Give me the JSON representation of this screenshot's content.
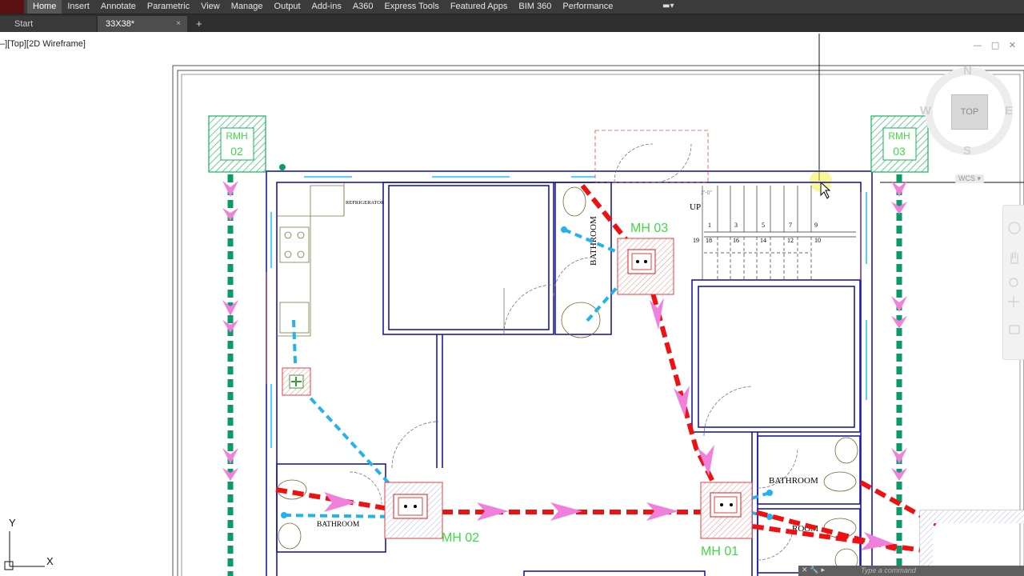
{
  "ribbon": {
    "tabs": [
      "Home",
      "Insert",
      "Annotate",
      "Parametric",
      "View",
      "Manage",
      "Output",
      "Add-ins",
      "A360",
      "Express Tools",
      "Featured Apps",
      "BIM 360",
      "Performance"
    ],
    "active_tab": "Home"
  },
  "file_tabs": {
    "start": "Start",
    "drawing": "33X38*",
    "close": "×",
    "add": "+"
  },
  "viewport": {
    "label": "–][Top][2D Wireframe]",
    "window_controls": "— □ ✕"
  },
  "nav_cube": {
    "n": "N",
    "s": "S",
    "e": "E",
    "w": "W",
    "face": "TOP",
    "wcs": "WCS ▾"
  },
  "command_line": {
    "buttons": "✕ 🔧 ▸",
    "placeholder": "Type a command"
  },
  "ucs": {
    "y": "Y",
    "x": "X"
  },
  "drawing": {
    "rmh_left": [
      "RMH",
      "02"
    ],
    "rmh_right": [
      "RMH",
      "03"
    ],
    "manholes": [
      "MH 03",
      "MH 02",
      "MH 01"
    ],
    "rooms": {
      "refrigerator": "REFRIGERATOR",
      "bathroom_top": "BATHROOM",
      "bathroom_left": "BATHROOM",
      "bathroom_right": "BATHROOM",
      "bathroom_right2": "ROOM"
    },
    "stair": {
      "up": "UP",
      "dim": "2'-0\"",
      "top_numbers": [
        "1",
        "3",
        "5",
        "7",
        "9"
      ],
      "bottom_numbers": [
        "19",
        "18",
        "16",
        "14",
        "12",
        "10"
      ]
    }
  },
  "colors": {
    "ribbon_bg": "#3b3b3b",
    "wall": "#1a1aa8",
    "sewer_red": "#ee1111",
    "arrow_pink": "#f080dc",
    "water_cyan": "#21b3ee",
    "storm_green": "#0c9a6a",
    "hatch_green": "#18b05a",
    "manhole_red": "#e04040"
  }
}
